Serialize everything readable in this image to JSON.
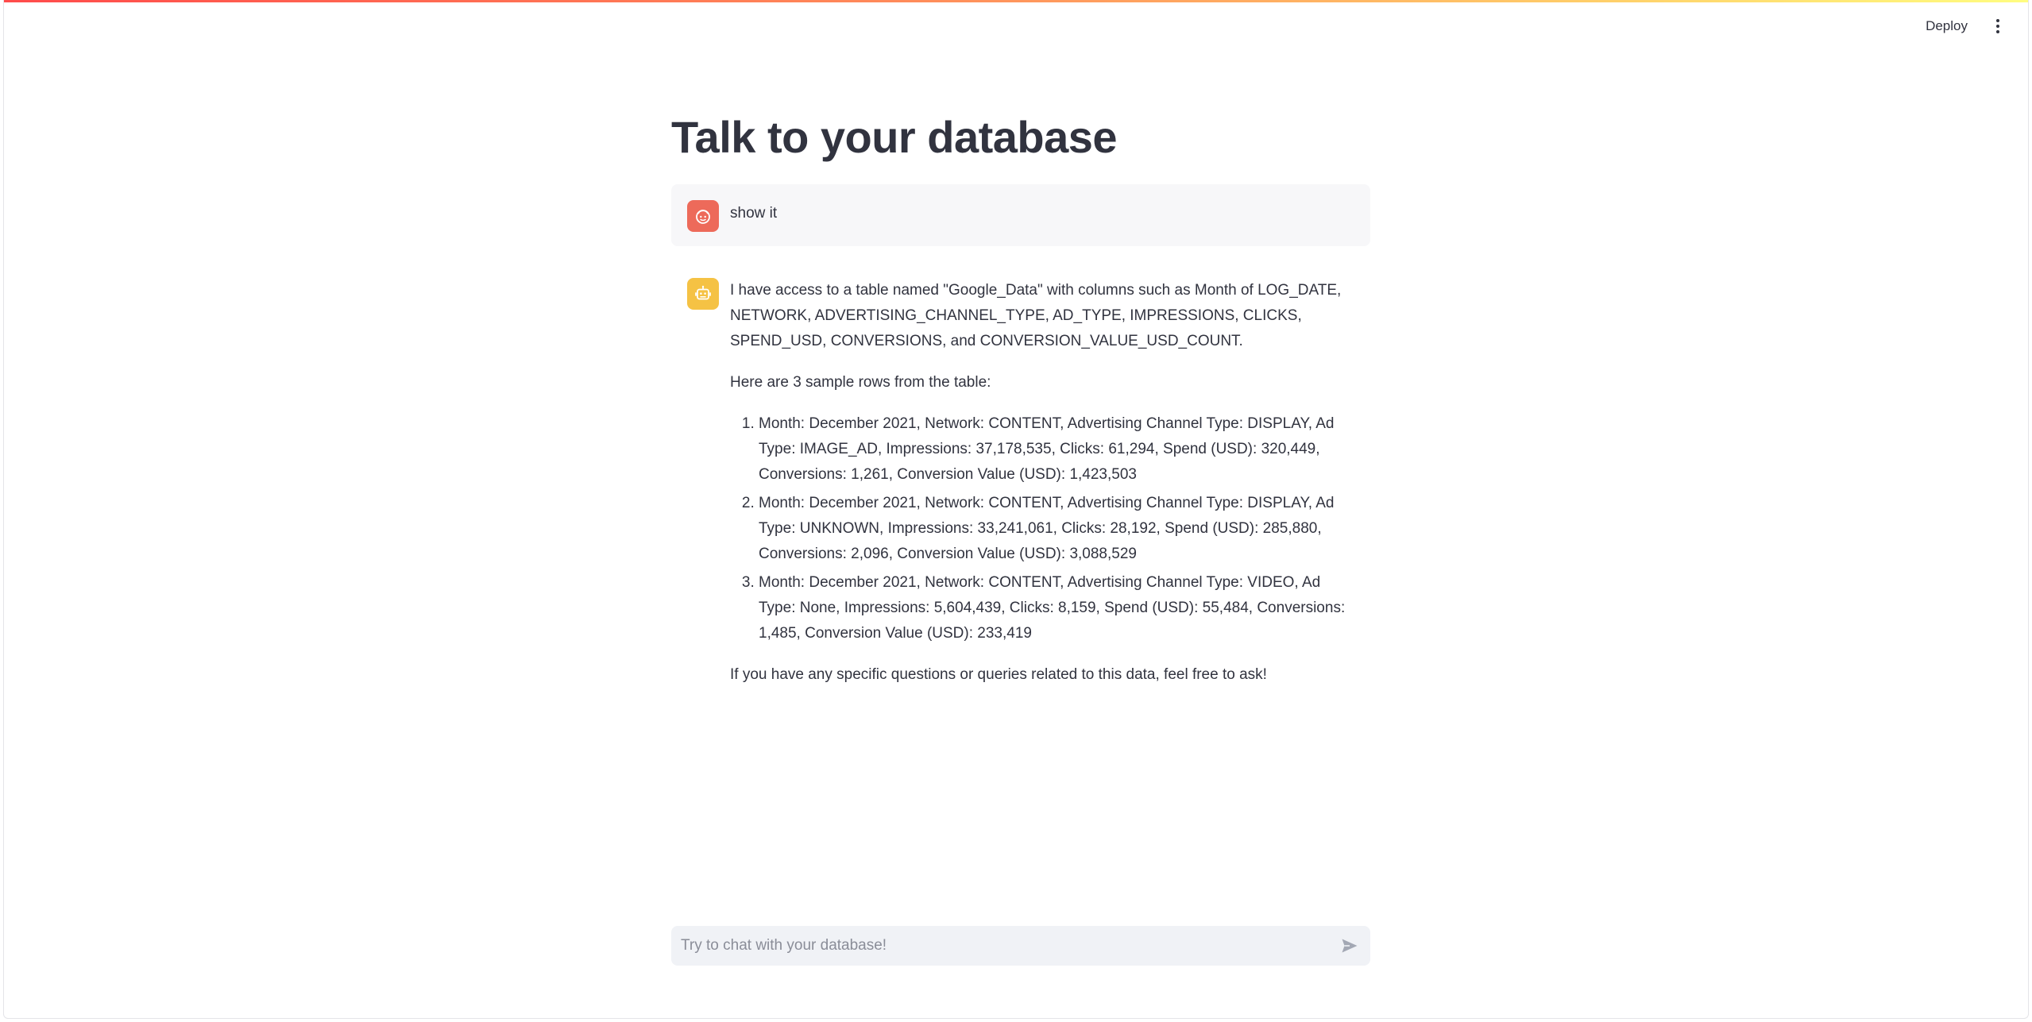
{
  "header": {
    "deploy_label": "Deploy",
    "menu_icon": "vertical-dots-icon"
  },
  "page": {
    "title": "Talk to your database"
  },
  "chat": {
    "user_message": {
      "avatar_icon": "user-face-icon",
      "avatar_color": "#ed6a5a",
      "text": "show it"
    },
    "assistant_message": {
      "avatar_icon": "robot-icon",
      "avatar_color": "#f5c244",
      "intro": "I have access to a table named \"Google_Data\" with columns such as Month of LOG_DATE, NETWORK, ADVERTISING_CHANNEL_TYPE, AD_TYPE, IMPRESSIONS, CLICKS, SPEND_USD, CONVERSIONS, and CONVERSION_VALUE_USD_COUNT.",
      "sample_heading": "Here are 3 sample rows from the table:",
      "rows": [
        "Month: December 2021, Network: CONTENT, Advertising Channel Type: DISPLAY, Ad Type: IMAGE_AD, Impressions: 37,178,535, Clicks: 61,294, Spend (USD): 320,449, Conversions: 1,261, Conversion Value (USD): 1,423,503",
        "Month: December 2021, Network: CONTENT, Advertising Channel Type: DISPLAY, Ad Type: UNKNOWN, Impressions: 33,241,061, Clicks: 28,192, Spend (USD): 285,880, Conversions: 2,096, Conversion Value (USD): 3,088,529",
        "Month: December 2021, Network: CONTENT, Advertising Channel Type: VIDEO, Ad Type: None, Impressions: 5,604,439, Clicks: 8,159, Spend (USD): 55,484, Conversions: 1,485, Conversion Value (USD): 233,419"
      ],
      "outro": "If you have any specific questions or queries related to this data, feel free to ask!"
    }
  },
  "input": {
    "placeholder": "Try to chat with your database!",
    "value": "",
    "send_icon": "send-arrow-icon"
  },
  "colors": {
    "accent": "#ff4b4b",
    "text": "#31333f",
    "input_bg": "#f0f2f6",
    "user_bubble_bg": "#f7f7f9"
  }
}
